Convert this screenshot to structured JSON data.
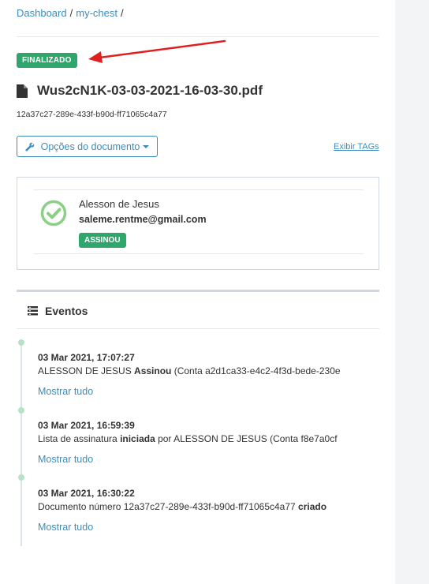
{
  "breadcrumb": {
    "home": "Dashboard",
    "folder": "my-chest",
    "separator": "/"
  },
  "document": {
    "status": "FINALIZADO",
    "filename": "Wus2cN1K-03-03-2021-16-03-30.pdf",
    "id": "12a37c27-289e-433f-b90d-ff71065c4a77",
    "options_label": "Opções do documento",
    "tags_link": "Exibir TAGs"
  },
  "signer": {
    "name": "Alesson de Jesus",
    "email": "saleme.rentme@gmail.com",
    "status": "ASSINOU"
  },
  "events": {
    "title": "Eventos",
    "items": [
      {
        "time": "03 Mar 2021, 17:07:27",
        "text_before": "ALESSON DE JESUS ",
        "text_bold": "Assinou",
        "text_after": " (Conta a2d1ca33-e4c2-4f3d-bede-230e",
        "more": "Mostrar tudo"
      },
      {
        "time": "03 Mar 2021, 16:59:39",
        "text_before": "Lista de assinatura ",
        "text_bold": "iniciada",
        "text_after": " por ALESSON DE JESUS (Conta f8e7a0cf",
        "more": "Mostrar tudo"
      },
      {
        "time": "03 Mar 2021, 16:30:22",
        "text_before": "Documento número 12a37c27-289e-433f-b90d-ff71065c4a77 ",
        "text_bold": "criado",
        "text_after": "",
        "more": "Mostrar tudo"
      }
    ]
  },
  "colors": {
    "accent": "#3c8dbc",
    "success": "#2fa66c",
    "annotation_arrow": "#e02020"
  },
  "icons": {
    "file": "file-icon",
    "wrench": "wrench-icon",
    "check": "check-circle-icon",
    "events": "list-icon"
  }
}
